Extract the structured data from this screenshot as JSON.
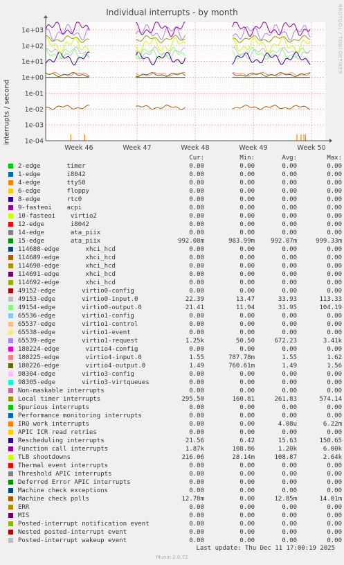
{
  "title": "Individual interrupts - by month",
  "side_label": "RRDTOOL / TOBI OETIKER",
  "footer": "Last update: Thu Dec 11 17:00:19 2025",
  "version": "Munin 2.0.73",
  "table_header": {
    "cur": "Cur:",
    "min": "Min:",
    "avg": "Avg:",
    "max": "Max:"
  },
  "chart_data": {
    "type": "line",
    "ylabel": "interrupts / second",
    "yscale": "log",
    "ylim": [
      0.0001,
      3000
    ],
    "yticks": [
      "1e+03",
      "1e+02",
      "1e+01",
      "1e+00",
      "1e-01",
      "1e-02",
      "1e-03",
      "1e-04"
    ],
    "xticks": [
      "Week 46",
      "Week 47",
      "Week 48",
      "Week 49",
      "Week 50"
    ],
    "grid": true,
    "data_gaps": [
      [
        "Week 46",
        "Week 47"
      ],
      [
        "Week 48",
        "Week 49"
      ]
    ],
    "series": [
      {
        "name": "2-edge       timer",
        "color": "#00cc00",
        "cur": "0.00",
        "min": "0.00",
        "avg": "0.00",
        "max": "0.00"
      },
      {
        "name": "1-edge       i8042",
        "color": "#0066b3",
        "cur": "0.00",
        "min": "0.00",
        "avg": "0.00",
        "max": "0.00"
      },
      {
        "name": "4-edge       ttyS0",
        "color": "#ff8000",
        "cur": "0.00",
        "min": "0.00",
        "avg": "0.00",
        "max": "0.00"
      },
      {
        "name": "6-edge       floppy",
        "color": "#ffcc00",
        "cur": "0.00",
        "min": "0.00",
        "avg": "0.00",
        "max": "0.00"
      },
      {
        "name": "8-edge       rtc0",
        "color": "#330099",
        "cur": "0.00",
        "min": "0.00",
        "avg": "0.00",
        "max": "0.00"
      },
      {
        "name": "9-fasteoi    acpi",
        "color": "#990099",
        "cur": "0.00",
        "min": "0.00",
        "avg": "0.00",
        "max": "0.00"
      },
      {
        "name": "10-fasteoi    virtio2",
        "color": "#ccff00",
        "cur": "0.00",
        "min": "0.00",
        "avg": "0.00",
        "max": "0.00"
      },
      {
        "name": "12-edge       i8042",
        "color": "#ff0000",
        "cur": "0.00",
        "min": "0.00",
        "avg": "0.00",
        "max": "0.00"
      },
      {
        "name": "14-edge       ata_piix",
        "color": "#808080",
        "cur": "0.00",
        "min": "0.00",
        "avg": "0.00",
        "max": "0.00"
      },
      {
        "name": "15-edge       ata_piix",
        "color": "#008f00",
        "cur": "992.08m",
        "min": "983.99m",
        "avg": "992.07m",
        "max": "999.33m"
      },
      {
        "name": "114688-edge       xhci_hcd",
        "color": "#00487d",
        "cur": "0.00",
        "min": "0.00",
        "avg": "0.00",
        "max": "0.00"
      },
      {
        "name": "114689-edge       xhci_hcd",
        "color": "#b35a00",
        "cur": "0.00",
        "min": "0.00",
        "avg": "0.00",
        "max": "0.00"
      },
      {
        "name": "114690-edge       xhci_hcd",
        "color": "#b38f00",
        "cur": "0.00",
        "min": "0.00",
        "avg": "0.00",
        "max": "0.00"
      },
      {
        "name": "114691-edge       xhci_hcd",
        "color": "#6b006b",
        "cur": "0.00",
        "min": "0.00",
        "avg": "0.00",
        "max": "0.00"
      },
      {
        "name": "114692-edge       xhci_hcd",
        "color": "#8fb300",
        "cur": "0.00",
        "min": "0.00",
        "avg": "0.00",
        "max": "0.00"
      },
      {
        "name": "49152-edge       virtio0-config",
        "color": "#b30000",
        "cur": "0.00",
        "min": "0.00",
        "avg": "0.00",
        "max": "0.00"
      },
      {
        "name": "49153-edge       virtio0-input.0",
        "color": "#bebebe",
        "cur": "22.39",
        "min": "13.47",
        "avg": "33.93",
        "max": "113.33"
      },
      {
        "name": "49154-edge       virtio0-output.0",
        "color": "#80ff80",
        "cur": "21.41",
        "min": "11.94",
        "avg": "31.95",
        "max": "104.19"
      },
      {
        "name": "65536-edge       virtio1-config",
        "color": "#80c9ff",
        "cur": "0.00",
        "min": "0.00",
        "avg": "0.00",
        "max": "0.00"
      },
      {
        "name": "65537-edge       virtio1-control",
        "color": "#ffc080",
        "cur": "0.00",
        "min": "0.00",
        "avg": "0.00",
        "max": "0.00"
      },
      {
        "name": "65538-edge       virtio1-event",
        "color": "#ffe680",
        "cur": "0.00",
        "min": "0.00",
        "avg": "0.00",
        "max": "0.00"
      },
      {
        "name": "65539-edge       virtio1-request",
        "color": "#aa80ff",
        "cur": "1.25k",
        "min": "50.50",
        "avg": "672.23",
        "max": "3.41k"
      },
      {
        "name": "180224-edge       virtio4-config",
        "color": "#ee00cc",
        "cur": "0.00",
        "min": "0.00",
        "avg": "0.00",
        "max": "0.00"
      },
      {
        "name": "180225-edge       virtio4-input.0",
        "color": "#ff8080",
        "cur": "1.55",
        "min": "787.78m",
        "avg": "1.55",
        "max": "1.62"
      },
      {
        "name": "180226-edge       virtio4-output.0",
        "color": "#666600",
        "cur": "1.49",
        "min": "760.61m",
        "avg": "1.49",
        "max": "1.56"
      },
      {
        "name": "98304-edge       virtio3-config",
        "color": "#ffbfff",
        "cur": "0.00",
        "min": "0.00",
        "avg": "0.00",
        "max": "0.00"
      },
      {
        "name": "98305-edge       virtio3-virtqueues",
        "color": "#00ffcc",
        "cur": "0.00",
        "min": "0.00",
        "avg": "0.00",
        "max": "0.00"
      },
      {
        "name": "Non-maskable interrupts",
        "color": "#cc6699",
        "cur": "0.00",
        "min": "0.00",
        "avg": "0.00",
        "max": "0.00"
      },
      {
        "name": "Local timer interrupts",
        "color": "#999900",
        "cur": "295.50",
        "min": "160.81",
        "avg": "261.83",
        "max": "574.14"
      },
      {
        "name": "Spurious interrupts",
        "color": "#00cc00",
        "cur": "0.00",
        "min": "0.00",
        "avg": "0.00",
        "max": "0.00"
      },
      {
        "name": "Performance monitoring interrupts",
        "color": "#0066b3",
        "cur": "0.00",
        "min": "0.00",
        "avg": "0.00",
        "max": "0.00"
      },
      {
        "name": "IRQ work interrupts",
        "color": "#ff8000",
        "cur": "0.00",
        "min": "0.00",
        "avg": "4.08u",
        "max": "6.22m"
      },
      {
        "name": "APIC ICR read retries",
        "color": "#ffcc00",
        "cur": "0.00",
        "min": "0.00",
        "avg": "0.00",
        "max": "0.00"
      },
      {
        "name": "Rescheduling interrupts",
        "color": "#330099",
        "cur": "21.56",
        "min": "6.42",
        "avg": "15.63",
        "max": "150.65"
      },
      {
        "name": "Function call interrupts",
        "color": "#990099",
        "cur": "1.87k",
        "min": "108.86",
        "avg": "1.20k",
        "max": "6.00k"
      },
      {
        "name": "TLB shootdowns",
        "color": "#ccff00",
        "cur": "216.06",
        "min": "28.14m",
        "avg": "108.87",
        "max": "2.64k"
      },
      {
        "name": "Thermal event interrupts",
        "color": "#ff0000",
        "cur": "0.00",
        "min": "0.00",
        "avg": "0.00",
        "max": "0.00"
      },
      {
        "name": "Threshold APIC interrupts",
        "color": "#808080",
        "cur": "0.00",
        "min": "0.00",
        "avg": "0.00",
        "max": "0.00"
      },
      {
        "name": "Deferred Error APIC interrupts",
        "color": "#008f00",
        "cur": "0.00",
        "min": "0.00",
        "avg": "0.00",
        "max": "0.00"
      },
      {
        "name": "Machine check exceptions",
        "color": "#00487d",
        "cur": "0.00",
        "min": "0.00",
        "avg": "0.00",
        "max": "0.00"
      },
      {
        "name": "Machine check polls",
        "color": "#b35a00",
        "cur": "12.78m",
        "min": "0.00",
        "avg": "12.85m",
        "max": "14.01m"
      },
      {
        "name": "ERR",
        "color": "#b38f00",
        "cur": "0.00",
        "min": "0.00",
        "avg": "0.00",
        "max": "0.00"
      },
      {
        "name": "MIS",
        "color": "#6b006b",
        "cur": "0.00",
        "min": "0.00",
        "avg": "0.00",
        "max": "0.00"
      },
      {
        "name": "Posted-interrupt notification event",
        "color": "#8fb300",
        "cur": "0.00",
        "min": "0.00",
        "avg": "0.00",
        "max": "0.00"
      },
      {
        "name": "Nested posted-interrupt event",
        "color": "#b30000",
        "cur": "0.00",
        "min": "0.00",
        "avg": "0.00",
        "max": "0.00"
      },
      {
        "name": "Posted-interrupt wakeup event",
        "color": "#bebebe",
        "cur": "0.00",
        "min": "0.00",
        "avg": "0.00",
        "max": "0.00"
      }
    ]
  }
}
